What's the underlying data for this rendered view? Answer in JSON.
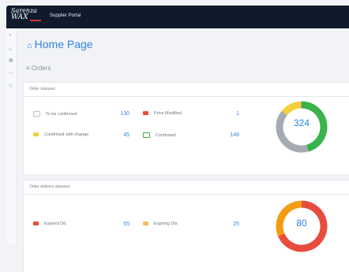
{
  "header": {
    "logo_line1": "Sarenza",
    "logo_line2": "WAX",
    "portal_name": "Supplier Portal"
  },
  "sidebar": {
    "icons": [
      "chevron-right-icon",
      "home-icon",
      "grid-icon",
      "list-icon",
      "tag-icon"
    ]
  },
  "page": {
    "title": "Home Page",
    "section": "Orders"
  },
  "order_statuses": {
    "title": "Order statuses",
    "items": [
      {
        "label": "To be confirmed",
        "value": "130",
        "color": "#c7ccd2"
      },
      {
        "label": "Price Modified",
        "value": "1",
        "color": "#e74c3c"
      },
      {
        "label": "Confirmed with change",
        "value": "45",
        "color": "#f3d03e"
      },
      {
        "label": "Confirmed",
        "value": "148",
        "color": "#38b44a"
      }
    ],
    "total": "324",
    "donut": [
      {
        "value": 148,
        "color": "#38b44a"
      },
      {
        "value": 130,
        "color": "#a5abb1"
      },
      {
        "value": 45,
        "color": "#f3d03e"
      },
      {
        "value": 1,
        "color": "#e74c3c"
      }
    ]
  },
  "delivery_statuses": {
    "title": "Order delivery statuses",
    "items": [
      {
        "label": "Expired Dd.",
        "value": "55",
        "color": "#e74c3c"
      },
      {
        "label": "Expiring Dts",
        "value": "25",
        "color": "#f39c12"
      }
    ],
    "total": "80",
    "donut": [
      {
        "value": 55,
        "color": "#e74c3c"
      },
      {
        "value": 25,
        "color": "#f39c12"
      }
    ]
  }
}
